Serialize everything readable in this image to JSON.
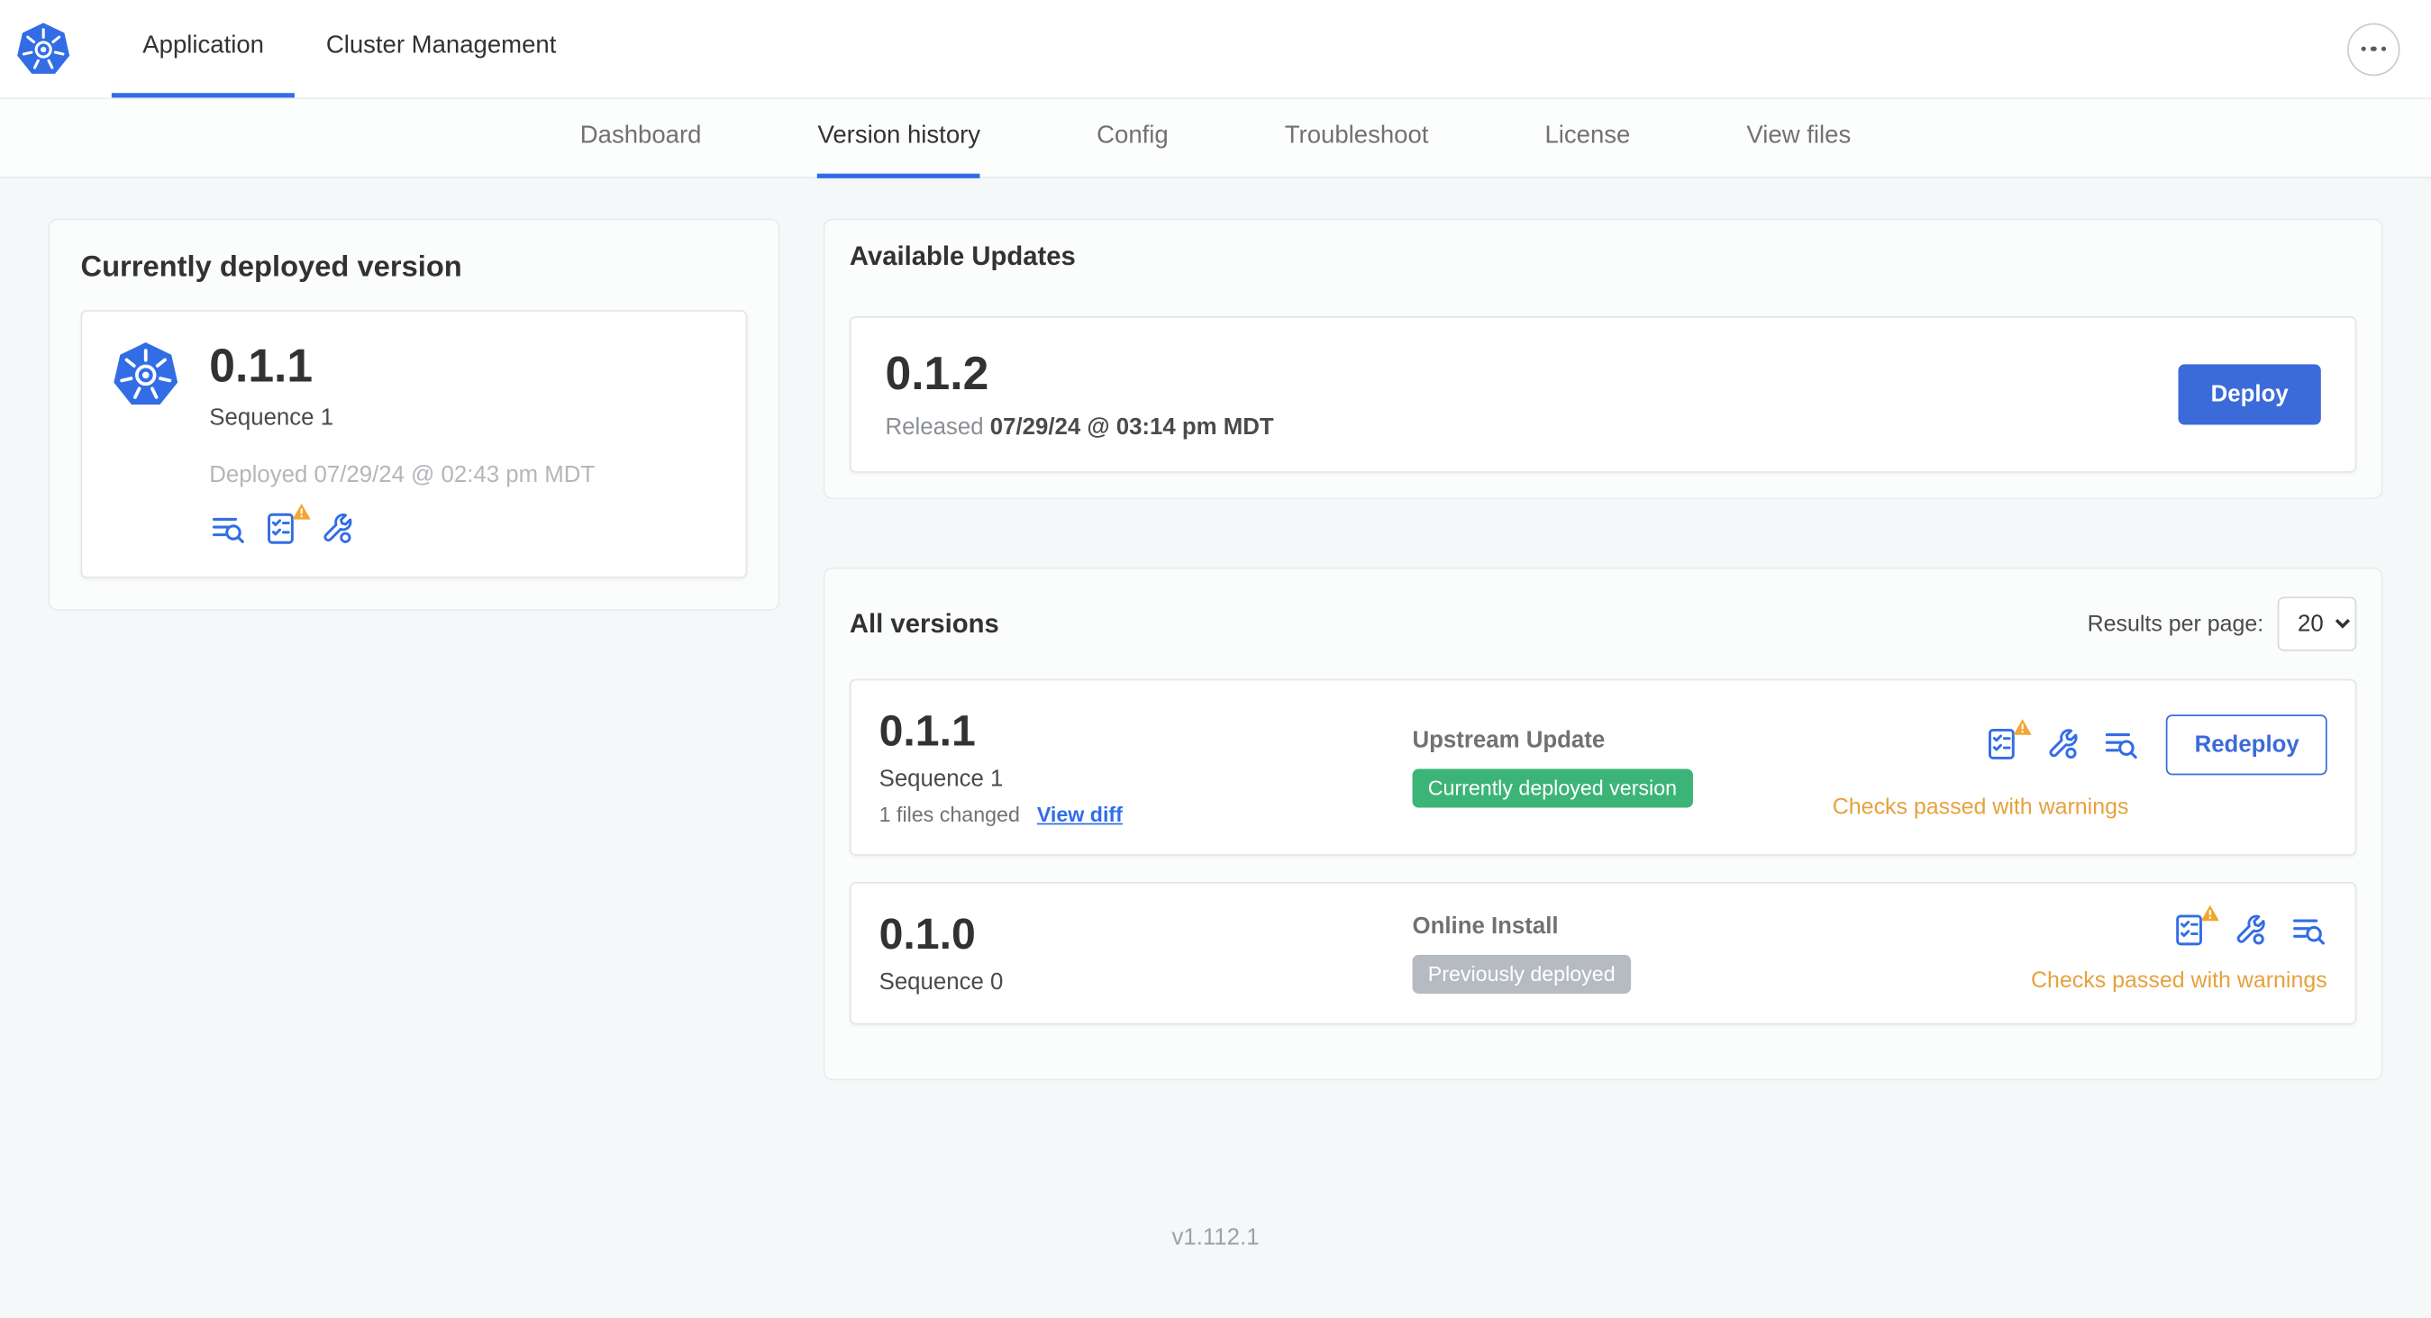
{
  "topbar": {
    "tabs": [
      {
        "label": "Application"
      },
      {
        "label": "Cluster Management"
      }
    ]
  },
  "subnav": {
    "tabs": [
      {
        "label": "Dashboard"
      },
      {
        "label": "Version history"
      },
      {
        "label": "Config"
      },
      {
        "label": "Troubleshoot"
      },
      {
        "label": "License"
      },
      {
        "label": "View files"
      }
    ],
    "active": "Version history"
  },
  "deployed_card": {
    "title": "Currently deployed version",
    "version": "0.1.1",
    "sequence": "Sequence 1",
    "deployed_at": "Deployed 07/29/24 @ 02:43 pm MDT"
  },
  "available_updates": {
    "title": "Available Updates",
    "version": "0.1.2",
    "released_label": "Released",
    "released_at": "07/29/24 @ 03:14 pm MDT",
    "deploy_label": "Deploy"
  },
  "all_versions": {
    "title": "All versions",
    "results_per_page_label": "Results per page:",
    "results_per_page_value": "20",
    "rows": [
      {
        "version": "0.1.1",
        "sequence": "Sequence 1",
        "files_changed": "1 files changed",
        "view_diff_label": "View diff",
        "source": "Upstream Update",
        "badge": "Currently deployed version",
        "badge_color": "green",
        "action_label": "Redeploy",
        "status": "Checks passed with warnings"
      },
      {
        "version": "0.1.0",
        "sequence": "Sequence 0",
        "source": "Online Install",
        "badge": "Previously deployed",
        "badge_color": "gray",
        "status": "Checks passed with warnings"
      }
    ]
  },
  "footer": {
    "version": "v1.112.1"
  },
  "icons": {
    "more": "ellipsis",
    "release_notes": "text-lines-with-magnifier",
    "preflight": "checklist",
    "config": "wrench",
    "warning": "triangle-exclamation"
  },
  "colors": {
    "accent_blue": "#326de6",
    "button_blue": "#3b6bd9",
    "badge_green": "#3cb477",
    "badge_gray": "#b5bbc0",
    "warning_orange": "#e7a13d",
    "page_bg": "#f5f8f9"
  }
}
